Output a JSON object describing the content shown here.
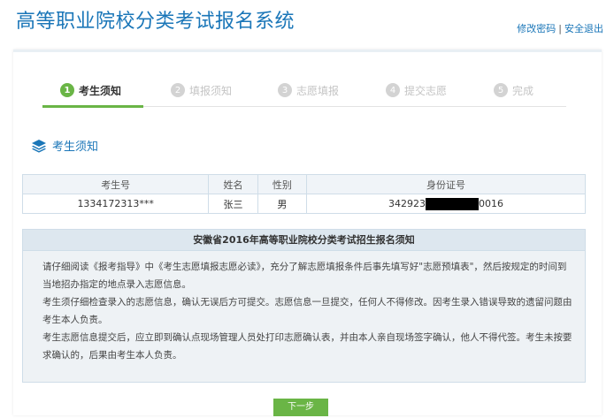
{
  "header": {
    "title": "高等职业院校分类考试报名系统",
    "change_password": "修改密码",
    "separator": "|",
    "logout": "安全退出"
  },
  "steps": [
    {
      "num": "1",
      "label": "考生须知",
      "active": true
    },
    {
      "num": "2",
      "label": "填报须知",
      "active": false
    },
    {
      "num": "3",
      "label": "志愿填报",
      "active": false
    },
    {
      "num": "4",
      "label": "提交志愿",
      "active": false
    },
    {
      "num": "5",
      "label": "完成",
      "active": false
    }
  ],
  "section": {
    "title": "考生须知",
    "icon": "stack-icon"
  },
  "table": {
    "headers": [
      "考生号",
      "姓名",
      "性别",
      "身份证号"
    ],
    "row": {
      "exam_no": "1334172313***",
      "name": "张三",
      "gender": "男",
      "id_prefix": "342923",
      "id_suffix": "0016"
    }
  },
  "notice": {
    "title": "安徽省2016年高等职业院校分类考试招生报名须知",
    "paragraphs": [
      "请仔细阅读《报考指导》中《考生志愿填报志愿必读》，充分了解志愿填报条件后事先填写好\"志愿预填表\"，然后按规定的时间到当地招办指定的地点录入志愿信息。",
      "考生须仔细检查录入的志愿信息，确认无误后方可提交。志愿信息一旦提交，任何人不得修改。因考生录入错误导致的遗留问题由考生本人负责。",
      "考生志愿信息提交后，应立即到确认点现场管理人员处打印志愿确认表，并由本人亲自现场签字确认，他人不得代签。考生未按要求确认的，后果由考生本人负责。"
    ]
  },
  "buttons": {
    "next": "下一步"
  },
  "colors": {
    "brand_blue": "#1a76b8",
    "step_active_green": "#6ab546",
    "step_inactive_gray": "#d3d3d3"
  }
}
